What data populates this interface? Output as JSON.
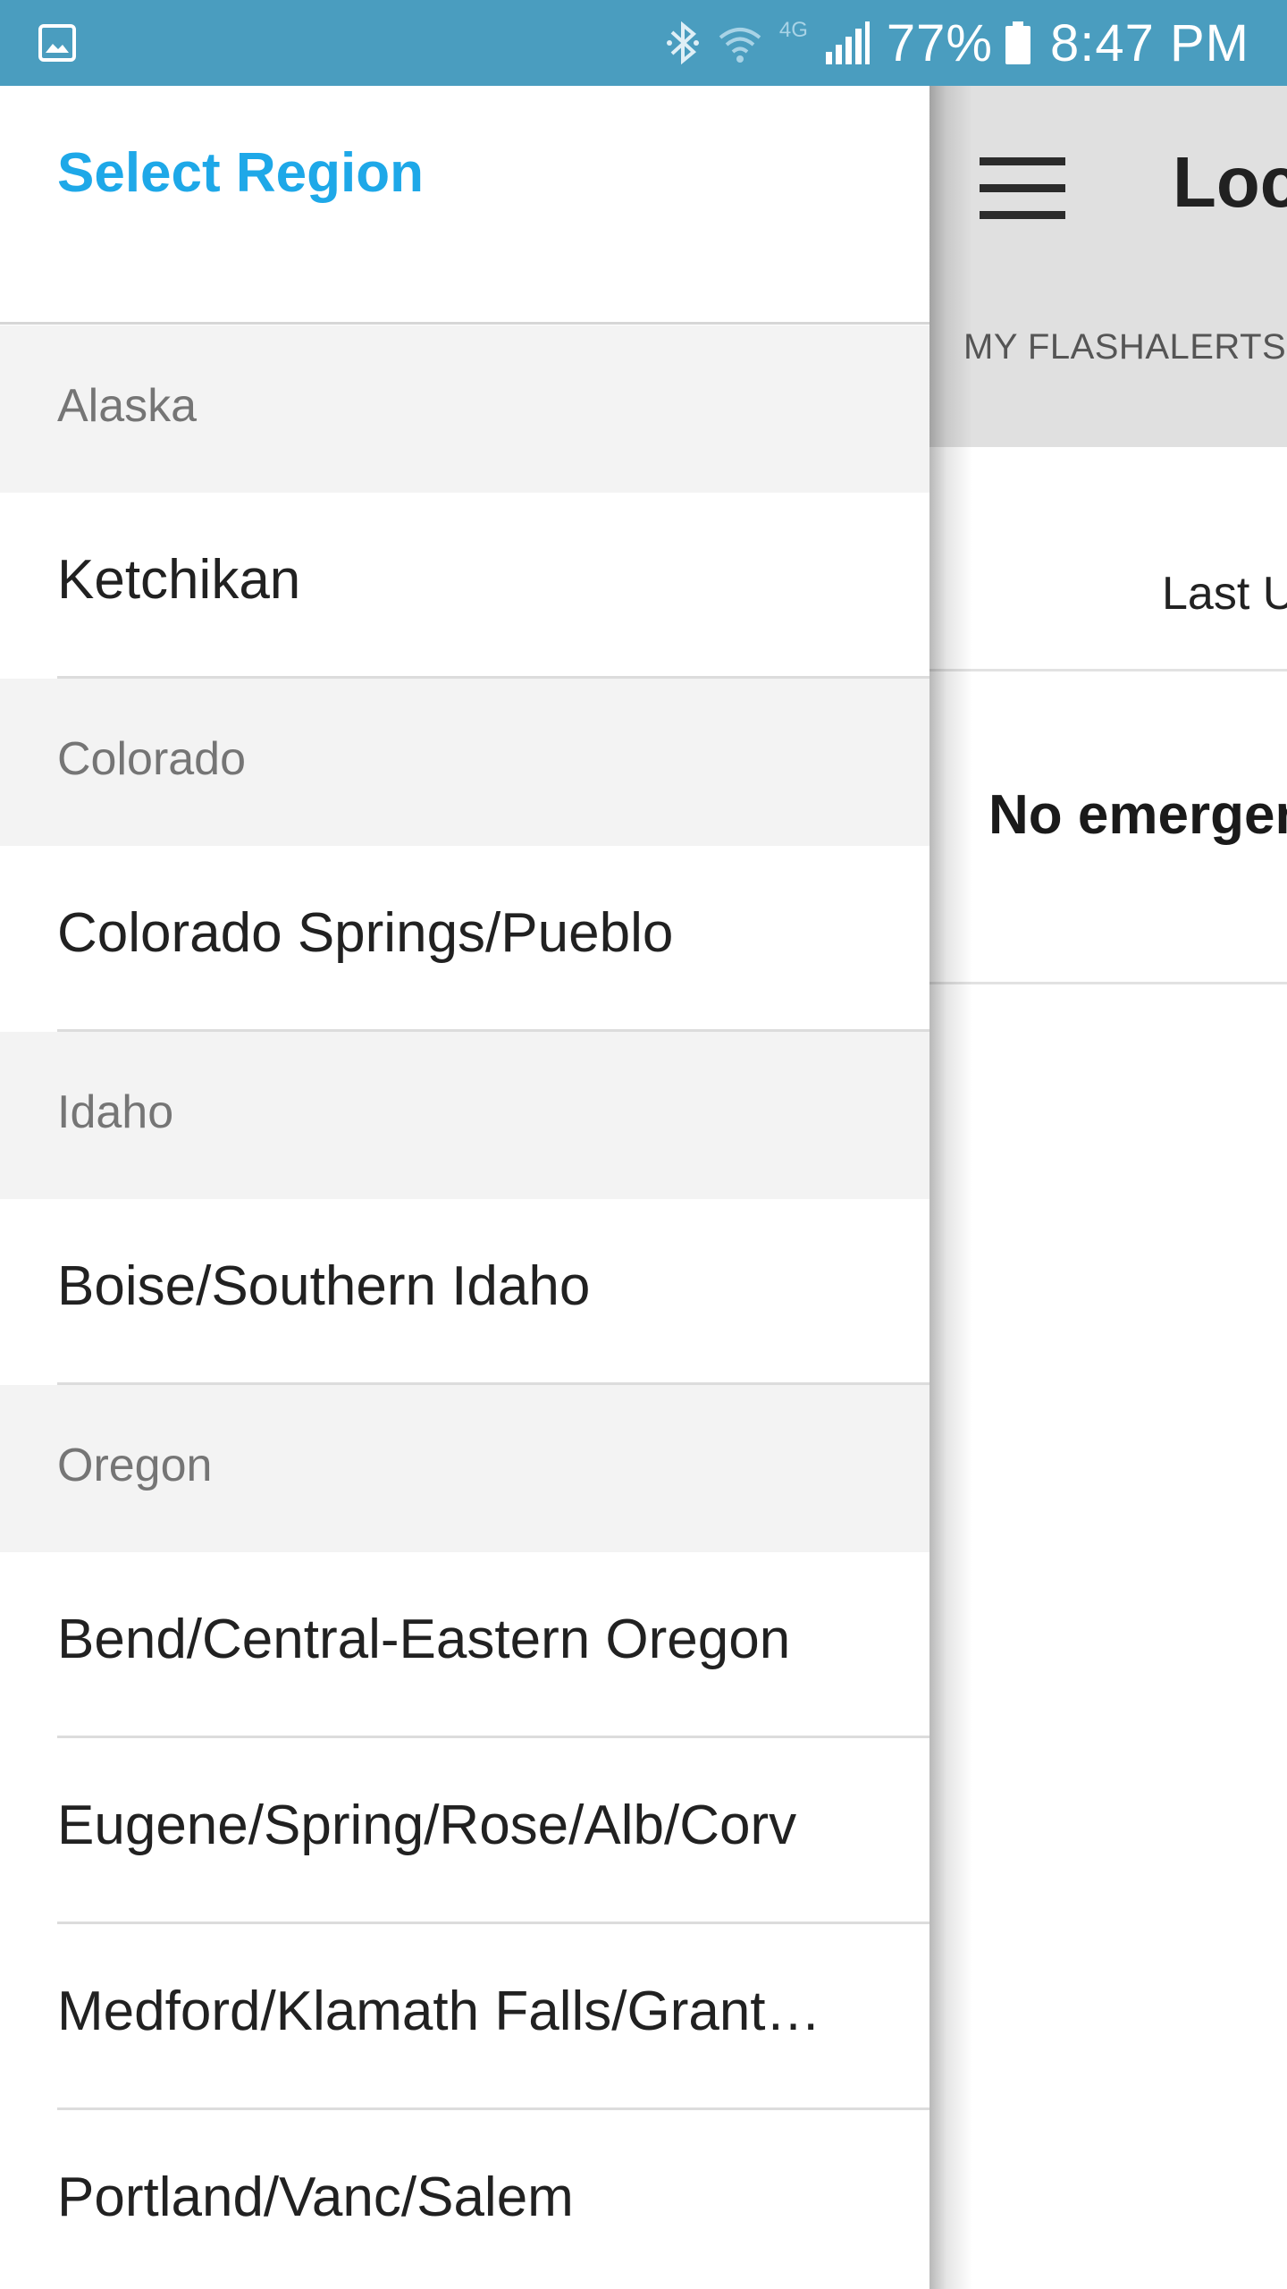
{
  "status_bar": {
    "battery": "77%",
    "time": "8:47 PM",
    "icons": [
      "gallery-notification-icon",
      "bluetooth-icon",
      "wifi-icon",
      "4g-lte-icon",
      "signal-icon",
      "battery-icon"
    ],
    "network_label": "4G"
  },
  "drawer": {
    "title": "Select Region",
    "title_color": "#1ea8e8",
    "sections": [
      {
        "state": "Alaska",
        "cities": [
          "Ketchikan"
        ]
      },
      {
        "state": "Colorado",
        "cities": [
          "Colorado Springs/Pueblo"
        ]
      },
      {
        "state": "Idaho",
        "cities": [
          "Boise/Southern Idaho"
        ]
      },
      {
        "state": "Oregon",
        "cities": [
          "Bend/Central-Eastern Oregon",
          "Eugene/Spring/Rose/Alb/Corv",
          "Medford/Klamath Falls/Grant…",
          "Portland/Vanc/Salem"
        ]
      }
    ]
  },
  "main": {
    "title": "Loc",
    "tab": "MY FLASHALERTS",
    "last_updated": "Last U",
    "no_emergency": "No emergen"
  },
  "colors": {
    "status_bar": "#4a9dbf",
    "header_bg": "#e0e0e0",
    "state_header_bg": "#f3f3f3"
  }
}
